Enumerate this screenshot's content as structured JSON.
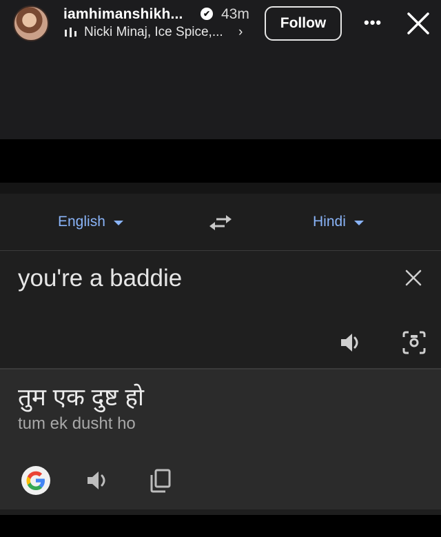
{
  "story": {
    "username": "iamhimanshikh...",
    "time_ago": "43m",
    "music": "Nicki Minaj, Ice Spice,...",
    "music_chevron": "›",
    "follow_label": "Follow",
    "more_label": "•••"
  },
  "translate": {
    "source_language": "English",
    "target_language": "Hindi",
    "source_text": "you're a baddie",
    "translated_text": "तुम एक दुष्ट हो",
    "transliteration": "tum ek dusht ho"
  },
  "colors": {
    "accent": "#8ab4f8",
    "panel": "#1f1f1f",
    "output_panel": "#2b2b2b",
    "story_bg": "#1c1c1e"
  },
  "icons": [
    "verified-badge-icon",
    "music-bars-icon",
    "more-icon",
    "close-icon",
    "swap-languages-icon",
    "clear-icon",
    "speaker-icon",
    "camera-icon",
    "google-icon",
    "copy-icon"
  ]
}
